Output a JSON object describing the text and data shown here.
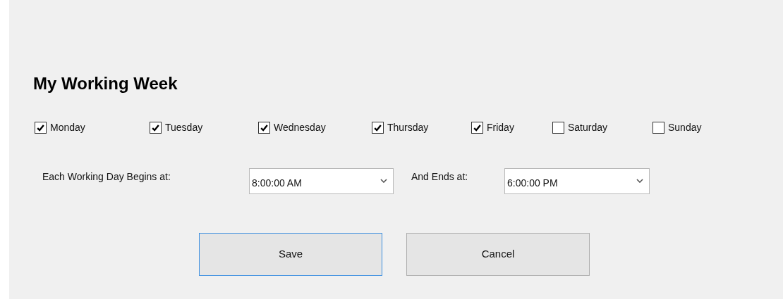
{
  "title": "My Working Week",
  "days": [
    {
      "label": "Monday",
      "checked": true
    },
    {
      "label": "Tuesday",
      "checked": true
    },
    {
      "label": "Wednesday",
      "checked": true
    },
    {
      "label": "Thursday",
      "checked": true
    },
    {
      "label": "Friday",
      "checked": true
    },
    {
      "label": "Saturday",
      "checked": false
    },
    {
      "label": "Sunday",
      "checked": false
    }
  ],
  "begins": {
    "label": "Each Working Day Begins at:",
    "value": "8:00:00 AM"
  },
  "ends": {
    "label": "And Ends at:",
    "value": "6:00:00 PM"
  },
  "buttons": [
    {
      "label": "Save",
      "focused": true
    },
    {
      "label": "Cancel",
      "focused": false
    }
  ]
}
